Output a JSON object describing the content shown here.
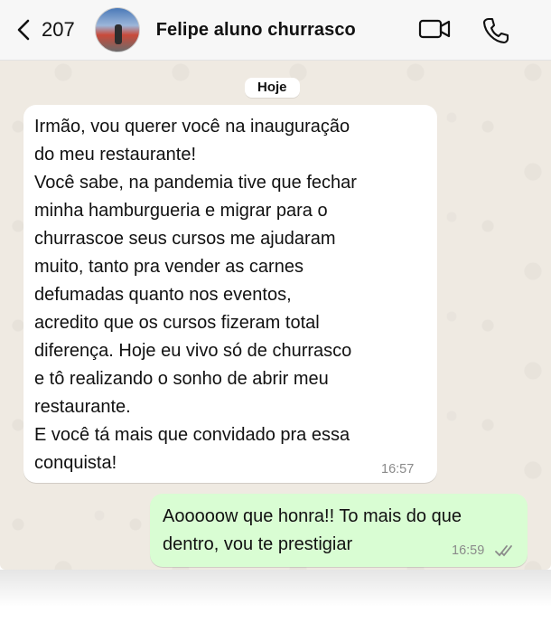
{
  "header": {
    "back_count": "207",
    "contact_name": "Felipe aluno churrasco"
  },
  "chat": {
    "day_label": "Hoje",
    "messages": [
      {
        "direction": "incoming",
        "text": "Irmão, vou querer você na inauguração\ndo meu restaurante!\nVocê sabe, na pandemia tive que fechar\nminha hamburgueria e migrar para o\nchurrascoe seus cursos me ajudaram\nmuito, tanto pra vender as carnes\ndefumadas quanto nos eventos,\nacredito que os cursos fizeram total\ndiferença. Hoje eu vivo só de churrasco\ne tô realizando o sonho de abrir meu\nrestaurante.\nE você tá mais que convidado pra essa\nconquista!",
        "time": "16:57"
      },
      {
        "direction": "outgoing",
        "text": "Aooooow que honra!! To mais do que\ndentro, vou te prestigiar",
        "time": "16:59",
        "status_icon": "double-check-icon"
      }
    ]
  },
  "colors": {
    "wallpaper": "#efeae2",
    "incoming_bubble": "#ffffff",
    "outgoing_bubble": "#d9fdd3"
  }
}
